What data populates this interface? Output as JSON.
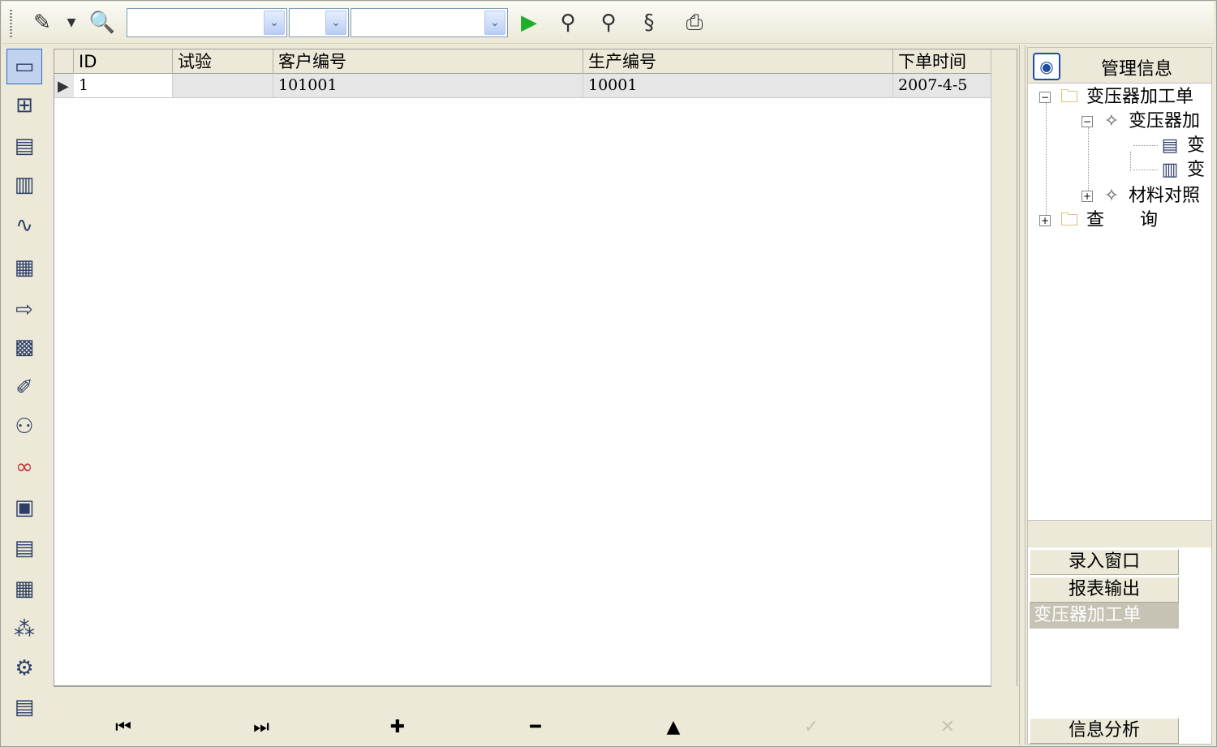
{
  "toolbar": {
    "icons": [
      "pencil-icon",
      "dropdown-arrow-icon",
      "magnifier-icon",
      "run-icon",
      "find-icon",
      "find-next-icon",
      "replace-icon",
      "print-icon"
    ],
    "combos": [
      {
        "value": ""
      },
      {
        "value": ""
      },
      {
        "value": ""
      }
    ]
  },
  "left_toolbar": {
    "icons": [
      "window-icon",
      "tree-diagram-icon",
      "form-icon",
      "document-icon",
      "chart-icon",
      "download-grid-icon",
      "import-icon",
      "table-icon",
      "edit-chart-icon",
      "users-search-icon",
      "relations-icon",
      "report-settings-icon",
      "document-settings-icon",
      "grid-export-icon",
      "matrix-icon",
      "workflow-icon",
      "list-icon"
    ]
  },
  "grid": {
    "columns": [
      "ID",
      "试验",
      "客户编号",
      "生产编号",
      "下单时间"
    ],
    "rows": [
      {
        "id": "1",
        "test": "",
        "customer_no": "101001",
        "production_no": "10001",
        "order_time": "2007-4-5"
      }
    ]
  },
  "navigator": {
    "buttons": [
      "first-record",
      "last-record",
      "insert-record",
      "delete-record",
      "edit-record",
      "post-record",
      "cancel-record"
    ]
  },
  "right_panel": {
    "title": "管理信息",
    "tree": [
      {
        "label": "变压器加工单"
      },
      {
        "label": "变压器加"
      },
      {
        "label": "变"
      },
      {
        "label": "变"
      },
      {
        "label": "材料对照"
      },
      {
        "label": "查　　询"
      }
    ],
    "buttons": [
      "录入窗口",
      "报表输出",
      "变压器加工单",
      "信息分析"
    ]
  }
}
